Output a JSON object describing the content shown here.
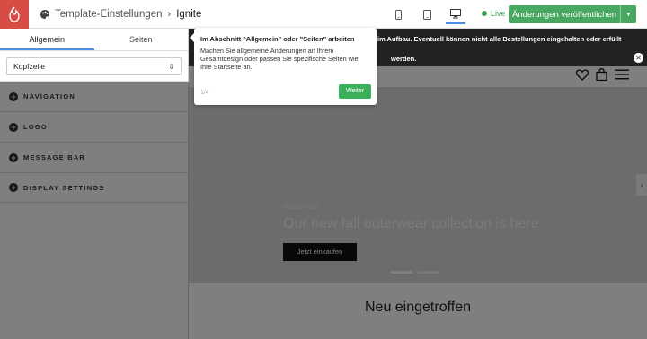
{
  "topbar": {
    "breadcrumb_parent": "Template-Einstellungen",
    "breadcrumb_current": "Ignite",
    "live_label": "Live",
    "publish_label": "Änderungen veröffentlichen"
  },
  "sidebar": {
    "tabs": [
      {
        "label": "Allgemein",
        "active": true
      },
      {
        "label": "Seiten",
        "active": false
      }
    ],
    "select_value": "Kopfzeile",
    "sections": [
      {
        "label": "NAVIGATION"
      },
      {
        "label": "LOGO"
      },
      {
        "label": "MESSAGE BAR"
      },
      {
        "label": "DISPLAY SETTINGS"
      }
    ]
  },
  "preview": {
    "banner_line1": "im Aufbau. Eventuell können nicht alle Bestellungen eingehalten oder erfüllt",
    "banner_line2": "werden.",
    "hero_kicker": "Season sale!",
    "hero_headline": "Our new fall outerwear collection is here",
    "hero_cta": "Jetzt einkaufen",
    "section_title": "Neu eingetroffen"
  },
  "tooltip": {
    "title": "Im Abschnitt \"Allgemein\" oder \"Seiten\" arbeiten",
    "body": "Machen Sie allgemeine Änderungen an Ihrem Gesamtdesign oder passen Sie spezifische Seiten wie Ihre Startseite an.",
    "step": "1/4",
    "next_label": "Weiter"
  },
  "colors": {
    "brand": "#d94b45",
    "publish": "#48a862",
    "accent": "#4a90e2",
    "next_button": "#3bb05a"
  }
}
